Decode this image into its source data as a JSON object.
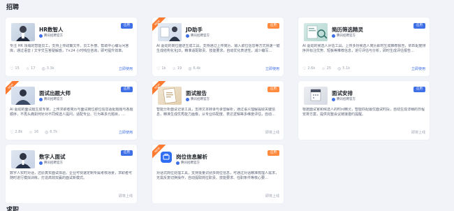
{
  "section_title": "招聘",
  "bottom_section_title": "求职",
  "cards": [
    {
      "id": "hr",
      "title": "HR数智人",
      "author": "腾讯招聘官方",
      "tag": "应用",
      "tag_color": "blue",
      "ribbon": "",
      "desc": "专注 HR 领域的智能员工，支持上传政策文件、员工手册、帮助中心编写问答库，通过语音 / 文字交互答疑解惑，7×24 小时响应咨询，即可提升效率。",
      "stats": [
        "15",
        "17",
        "3.3k"
      ],
      "action": "立即使用",
      "action_style": "link"
    },
    {
      "id": "jd",
      "title": "JD助手",
      "author": "腾讯招聘官方",
      "tag": "应用",
      "tag_color": "orange",
      "ribbon": "NEW",
      "desc": "AI 驱动的岗位描述生成工具，支持通过上传简历、输入职位信息等方式快速一键生成结构化化JD，精准适配职责、技能要求，自动优化表述性，减少编写…",
      "stats": [
        "1k",
        "19",
        "6.4k"
      ],
      "action": "立即使用",
      "action_style": "link"
    },
    {
      "id": "screen",
      "title": "简历筛选精灵",
      "author": "腾讯招聘官方",
      "tag": "应用",
      "tag_color": "blue",
      "ribbon": "",
      "desc": "AI 驱动的候选人评估工具，上传多份候选人简历即时生成推荐报告，依匹配度排序并标注优势、短板等推荐信息，进行评估与分析，即时生成评估报告…",
      "stats": [
        "2.6k",
        "25",
        "5.1k"
      ],
      "action": "立即使用",
      "action_style": "link"
    },
    {
      "id": "qmaster",
      "title": "面试出题大师",
      "author": "腾讯招聘官方",
      "tag": "应用",
      "tag_color": "blue",
      "ribbon": "NEW",
      "desc": "AI 驱动的面试题生成专家，上传求职者简历与面试岗位职位信息适配题题与各题顺序，不再头痛如何针对不同候选人提问，适配专业、行为等多元题目，…",
      "stats": [
        "2.8k",
        "16",
        "6.7k"
      ],
      "action": "立即使用",
      "action_style": "link"
    },
    {
      "id": "report",
      "title": "面试报告",
      "author": "腾讯招聘官方",
      "tag": "应用",
      "tag_color": "orange",
      "ribbon": "NEW",
      "desc": "智能分析面试记录工具，支持文本转录与录音解析，通过语义理解提取关键信息，精准生成优秀能力画像，从专业匹配度、表达逻辑等多维度评估，自动…",
      "stats": [],
      "action": "即将上线",
      "action_style": "gray"
    },
    {
      "id": "arrange",
      "title": "面试安排",
      "author": "腾讯招聘官方",
      "tag": "应用",
      "tag_color": "blue",
      "ribbon": "",
      "desc": "根据面试官和候选人的时间精灵，智能匹配最优面试时段，自动生成详细的日程安排方案，提供完整会议链接邀约提醒。",
      "stats": [],
      "action": "即将上线",
      "action_style": "gray"
    },
    {
      "id": "digital",
      "title": "数字人面试",
      "author": "腾讯招聘官方",
      "tag": "应用",
      "tag_color": "blue",
      "ribbon": "",
      "desc": "数字人实时对话，还原真实面试体验。企业可快速定制专属考核场景，求职者可随时进行模拟训练，打造高效双赢的面试新模式。",
      "stats": [],
      "action": "即将上线",
      "action_style": "gray"
    },
    {
      "id": "position",
      "title": "岗位信息解析",
      "author": "腾讯招聘官方",
      "tag": "应用",
      "tag_color": "orange",
      "ribbon": "NEW",
      "desc": "对话式岗位处理工具，支持批量识别多岗位信息，可通过对话精准梳理人需求，无需反复切换操作，自动提取岗位职责、技能要求、任职条件等核心要…",
      "stats": [],
      "action": "即将上线",
      "action_style": "gray"
    }
  ]
}
